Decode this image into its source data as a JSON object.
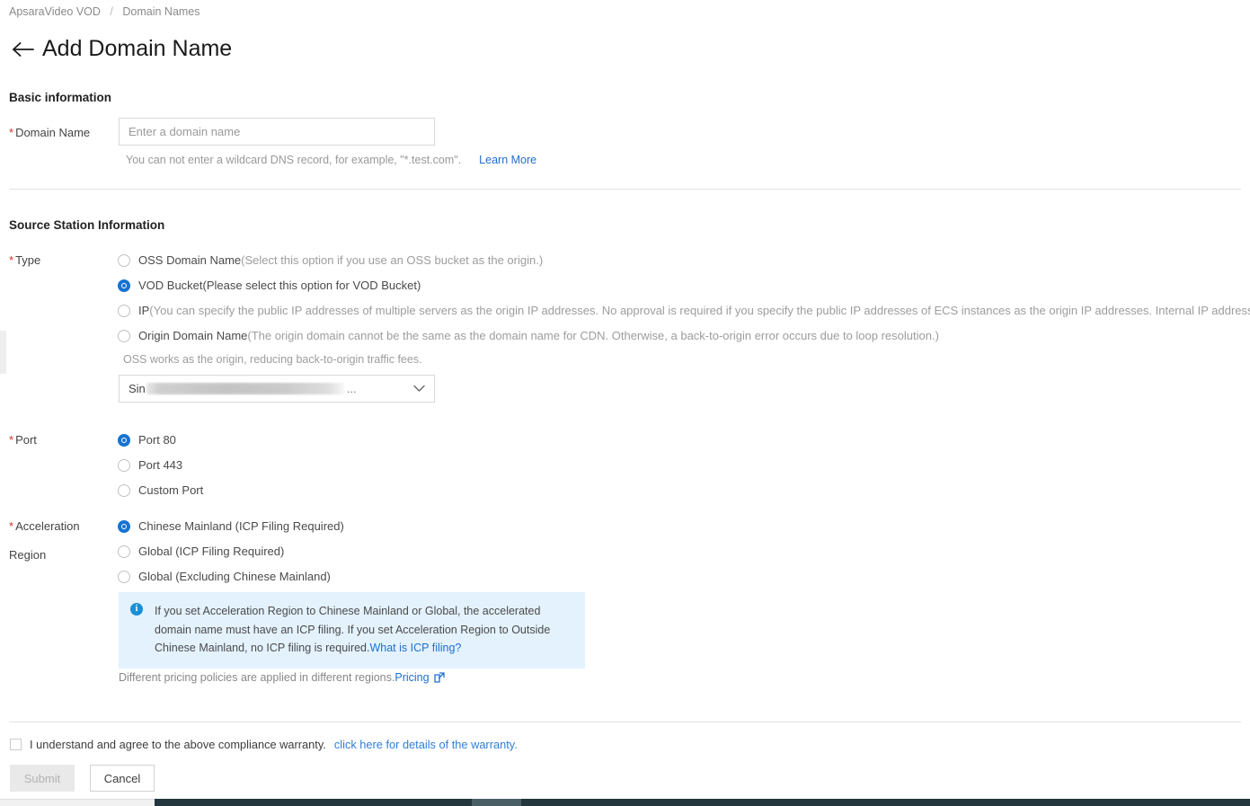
{
  "breadcrumb": {
    "root": "ApsaraVideo VOD",
    "separator": "/",
    "current": "Domain Names"
  },
  "header": {
    "back_icon": "arrow-left-icon",
    "title": "Add Domain Name"
  },
  "basic_information": {
    "section_title": "Basic information",
    "domain_name": {
      "required_marker": "*",
      "label": "Domain Name",
      "value": "",
      "placeholder": "Enter a domain name",
      "helper_text": "You can not enter a wildcard DNS record, for example, \"*.test.com\".",
      "helper_link": "Learn More"
    }
  },
  "source_station_information": {
    "section_title": "Source Station Information",
    "type": {
      "required_marker": "*",
      "label": "Type",
      "options": [
        {
          "id": "oss-domain-name",
          "label": "OSS Domain Name",
          "description": "(Select this option if you use an OSS bucket as the origin.)",
          "selected": false
        },
        {
          "id": "vod-bucket",
          "label": "VOD Bucket",
          "description": "(Please select this option for VOD Bucket)",
          "selected": true
        },
        {
          "id": "ip",
          "label": "IP",
          "description": "(You can specify the public IP addresses of multiple servers as the origin IP addresses. No approval is required if you specify the public IP addresses of ECS instances as the origin IP addresses. Internal IP addresses are not supported.)",
          "selected": false
        },
        {
          "id": "origin-domain-name",
          "label": "Origin Domain Name",
          "description": "(The origin domain cannot be the same as the domain name for CDN. Otherwise, a back-to-origin error occurs due to loop resolution.)",
          "selected": false
        }
      ],
      "note": "OSS works as the origin, reducing back-to-origin traffic fees.",
      "bucket_select": {
        "value_prefix": "Sin",
        "value_redacted": true,
        "value_suffix": "...",
        "caret_icon": "chevron-down-icon"
      }
    },
    "port": {
      "required_marker": "*",
      "label": "Port",
      "options": [
        {
          "id": "port-80",
          "label": "Port 80",
          "selected": true
        },
        {
          "id": "port-443",
          "label": "Port 443",
          "selected": false
        },
        {
          "id": "custom-port",
          "label": "Custom Port",
          "selected": false
        }
      ]
    },
    "acceleration_region": {
      "required_marker": "*",
      "label_line1": "Acceleration",
      "label_line2": "Region",
      "options": [
        {
          "id": "chinese-mainland",
          "label": "Chinese Mainland (ICP Filing Required)",
          "selected": true
        },
        {
          "id": "global-icp",
          "label": "Global (ICP Filing Required)",
          "selected": false
        },
        {
          "id": "global-excluding-mainland",
          "label": "Global (Excluding Chinese Mainland)",
          "selected": false
        }
      ],
      "alert": {
        "icon": "info-icon",
        "text": "If you set Acceleration Region to Chinese Mainland or Global, the accelerated domain name must have an ICP filing. If you set Acceleration Region to Outside Chinese Mainland, no ICP filing is required.",
        "link": "What is ICP filing?"
      },
      "pricing_note": "Different pricing policies are applied in different regions.",
      "pricing_link": "Pricing",
      "pricing_link_icon": "external-link-icon"
    }
  },
  "footer": {
    "agreement_text": "I understand and agree to the above compliance warranty.",
    "agreement_link": "click here for details of the warranty.",
    "agreement_checked": false,
    "submit_label": "Submit",
    "submit_disabled": true,
    "cancel_label": "Cancel"
  },
  "colors": {
    "accent": "#1673d1",
    "link": "#1f6fd0",
    "required": "#d93026",
    "alert_bg": "#e4f2fd",
    "info_icon": "#1890d8",
    "taskbar": "#23353d"
  }
}
